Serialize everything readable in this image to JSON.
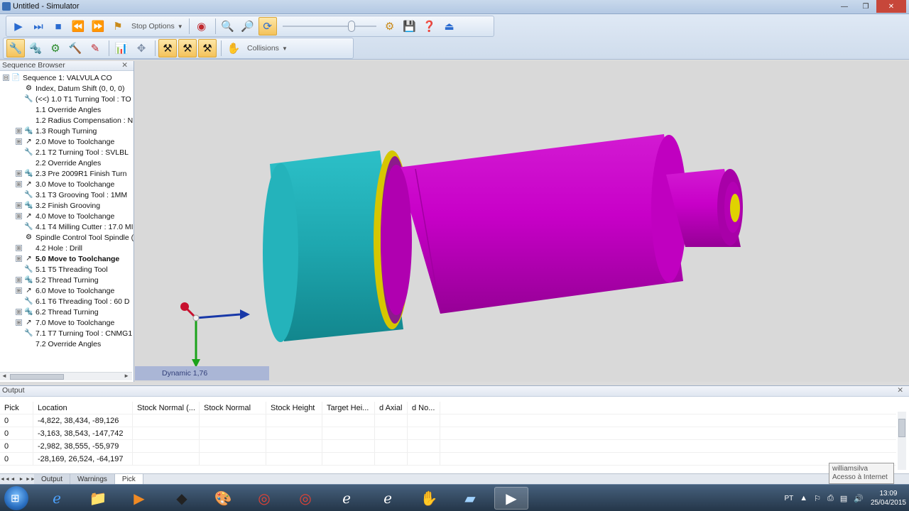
{
  "window": {
    "title": "Untitled - Simulator",
    "minimize": "—",
    "restore": "❐",
    "close": "✕"
  },
  "toolbar": {
    "stop_options": "Stop Options",
    "collisions": "Collisions"
  },
  "sequence_browser": {
    "title": "Sequence Browser",
    "close": "✕",
    "items": [
      {
        "label": "Sequence 1: VALVULA CO",
        "expander": "⊟",
        "icon": "📄",
        "bold": false
      },
      {
        "label": "Index, Datum Shift (0, 0, 0)",
        "expander": "",
        "icon": "⚙",
        "bold": false
      },
      {
        "label": "(<<) 1.0 T1 Turning Tool : TO",
        "expander": "",
        "icon": "🔧",
        "bold": false
      },
      {
        "label": "1.1 Override Angles",
        "expander": "",
        "icon": "",
        "bold": false
      },
      {
        "label": "1.2 Radius Compensation : N",
        "expander": "",
        "icon": "",
        "bold": false
      },
      {
        "label": "1.3 Rough Turning",
        "expander": "⊞",
        "icon": "🔩",
        "bold": false
      },
      {
        "label": "2.0 Move to Toolchange",
        "expander": "⊞",
        "icon": "↗",
        "bold": false
      },
      {
        "label": "2.1 T2 Turning Tool : SVLBL",
        "expander": "",
        "icon": "🔧",
        "bold": false
      },
      {
        "label": "2.2 Override Angles",
        "expander": "",
        "icon": "",
        "bold": false
      },
      {
        "label": "2.3 Pre 2009R1 Finish Turn",
        "expander": "⊞",
        "icon": "🔩",
        "bold": false
      },
      {
        "label": "3.0 Move to Toolchange",
        "expander": "⊞",
        "icon": "↗",
        "bold": false
      },
      {
        "label": "3.1 T3 Grooving Tool : 1MM",
        "expander": "",
        "icon": "🔧",
        "bold": false
      },
      {
        "label": "3.2 Finish Grooving",
        "expander": "⊞",
        "icon": "🔩",
        "bold": false
      },
      {
        "label": "4.0 Move to Toolchange",
        "expander": "⊞",
        "icon": "↗",
        "bold": false
      },
      {
        "label": "4.1 T4 Milling Cutter : 17.0 MI",
        "expander": "",
        "icon": "🔧",
        "bold": false
      },
      {
        "label": "Spindle Control Tool Spindle (",
        "expander": "",
        "icon": "⚙",
        "bold": false
      },
      {
        "label": "4.2 Hole : Drill",
        "expander": "⊞",
        "icon": "",
        "bold": false
      },
      {
        "label": "5.0 Move to Toolchange",
        "expander": "⊞",
        "icon": "↗",
        "bold": true
      },
      {
        "label": "5.1 T5 Threading Tool",
        "expander": "",
        "icon": "🔧",
        "bold": false
      },
      {
        "label": "5.2 Thread Turning",
        "expander": "⊞",
        "icon": "🔩",
        "bold": false
      },
      {
        "label": "6.0 Move to Toolchange",
        "expander": "⊞",
        "icon": "↗",
        "bold": false
      },
      {
        "label": "6.1 T6 Threading Tool : 60 D",
        "expander": "",
        "icon": "🔧",
        "bold": false
      },
      {
        "label": "6.2 Thread Turning",
        "expander": "⊞",
        "icon": "🔩",
        "bold": false
      },
      {
        "label": "7.0 Move to Toolchange",
        "expander": "⊞",
        "icon": "↗",
        "bold": false
      },
      {
        "label": "7.1 T7 Turning Tool : CNMG1",
        "expander": "",
        "icon": "🔧",
        "bold": false
      },
      {
        "label": "7.2 Override Angles",
        "expander": "",
        "icon": "",
        "bold": false
      }
    ]
  },
  "viewport": {
    "status": "Dynamic 1,76"
  },
  "output": {
    "title": "Output",
    "close": "✕",
    "columns": [
      "Pick",
      "Location",
      "Stock Normal (...",
      "Stock Normal",
      "Stock Height",
      "Target Hei...",
      "d Axial",
      "d No..."
    ],
    "rows": [
      [
        "0",
        "-4,822, 38,434, -89,126",
        "",
        "",
        "",
        "",
        "",
        ""
      ],
      [
        "0",
        "-3,163, 38,543, -147,742",
        "",
        "",
        "",
        "",
        "",
        ""
      ],
      [
        "0",
        "-2,982, 38,555, -55,979",
        "",
        "",
        "",
        "",
        "",
        ""
      ],
      [
        "0",
        "-28,169, 26,524, -64,197",
        "",
        "",
        "",
        "",
        "",
        ""
      ]
    ],
    "tabs": [
      "Output",
      "Warnings",
      "Pick"
    ],
    "active_tab": "Pick"
  },
  "tooltip": {
    "line1": "williamsilva",
    "line2": "Acesso à Internet"
  },
  "tray": {
    "language": "PT",
    "time": "13:09",
    "date": "25/04/2015"
  },
  "colors": {
    "stock_cyan": "#1fa8b0",
    "part_magenta": "#c800c8",
    "yellow_ring": "#d8c800",
    "viewport_bg": "#d9d9d9"
  }
}
